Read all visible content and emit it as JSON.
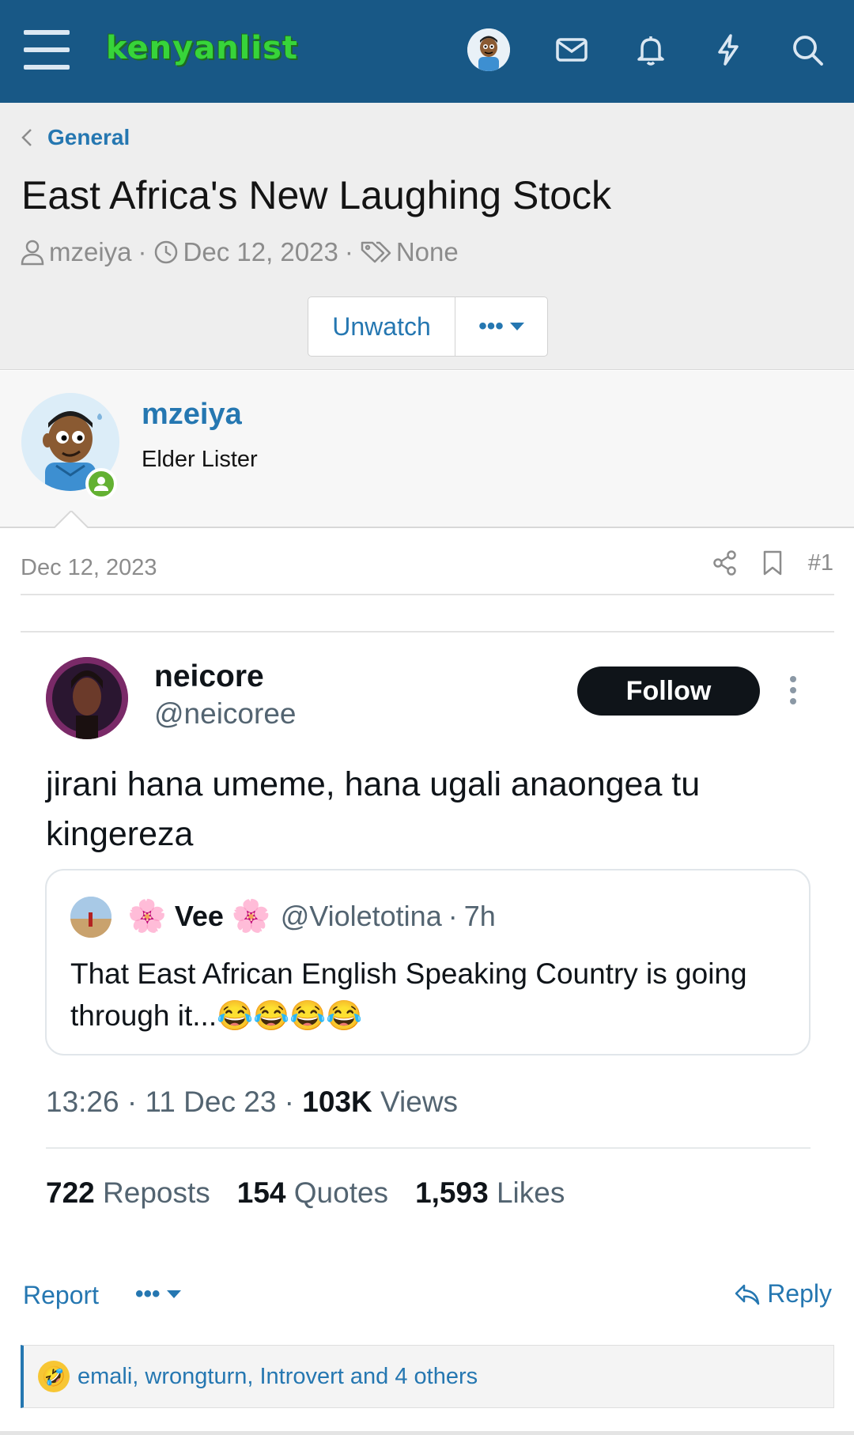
{
  "header": {
    "logo": "kenyanlist",
    "icons": [
      "menu-icon",
      "mail-icon",
      "bell-icon",
      "lightning-icon",
      "search-icon"
    ],
    "bg_color": "#185886"
  },
  "thread": {
    "breadcrumb": "General",
    "title": "East Africa's New Laughing Stock",
    "author": "mzeiya",
    "date": "Dec 12, 2023",
    "tags": "None",
    "watch_label": "Unwatch",
    "more_label": "•••"
  },
  "user": {
    "name": "mzeiya",
    "title": "Elder Lister",
    "status": "online"
  },
  "post": {
    "date": "Dec 12, 2023",
    "number": "#1"
  },
  "tweet": {
    "name": "neicore",
    "handle": "@neicoree",
    "follow_label": "Follow",
    "text": "jirani hana umeme, hana ugali anaongea tu kingereza",
    "quote": {
      "flower": "🌸",
      "name": "Vee",
      "handle": "@Violetotina",
      "sep": "·",
      "age": "7h",
      "text": "That East African English Speaking Country is going through it...😂😂😂😂"
    },
    "time": "13:26 · 11 Dec 23 ·",
    "views_count": "103K",
    "views_label": "Views",
    "reposts_count": "722",
    "reposts_label": "Reposts",
    "quotes_count": "154",
    "quotes_label": "Quotes",
    "likes_count": "1,593",
    "likes_label": "Likes"
  },
  "footer": {
    "report_label": "Report",
    "more_label": "•••",
    "reply_label": "Reply",
    "reaction_emoji": "🤣",
    "reactions_text": "emali, wrongturn, Introvert and 4 others"
  }
}
